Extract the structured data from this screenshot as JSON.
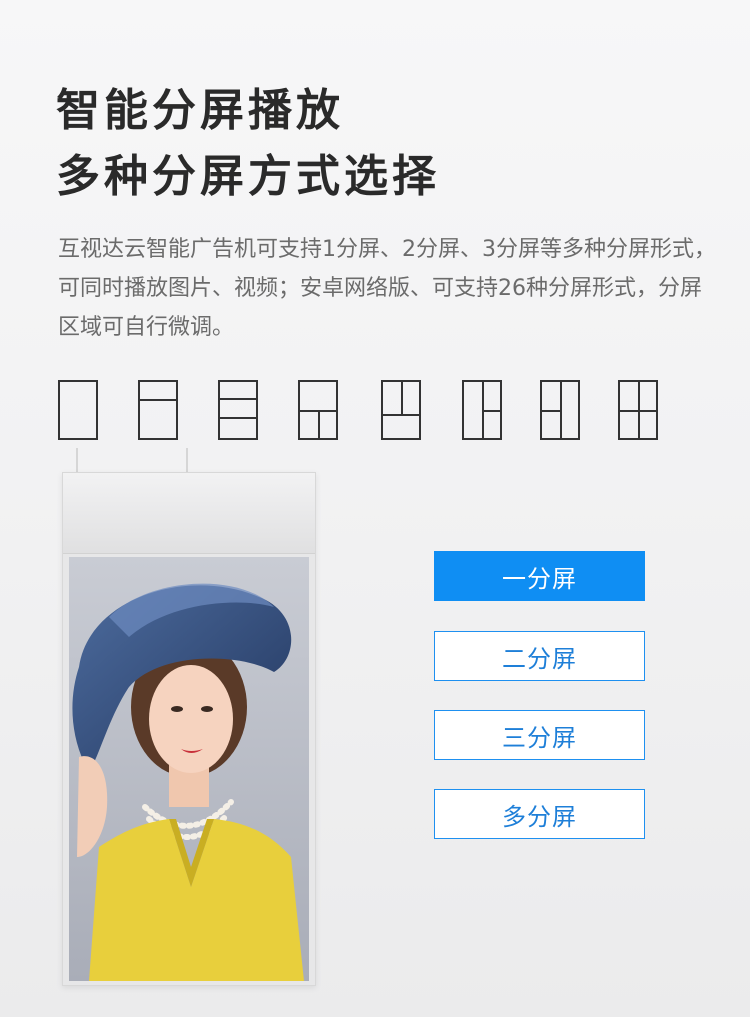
{
  "heading": {
    "line1": "智能分屏播放",
    "line2": "多种分屏方式选择"
  },
  "description": "互视达云智能广告机可支持1分屏、2分屏、3分屏等多种分屏形式，可同时播放图片、视频；安卓网络版、可支持26种分屏形式，分屏区域可自行微调。",
  "layout_icons": [
    "one-split-layout-icon",
    "two-split-layout-icon",
    "three-split-layout-icon",
    "three-split-t-layout-icon",
    "three-split-top-layout-icon",
    "three-split-side-layout-icon",
    "three-split-side-alt-layout-icon",
    "four-split-layout-icon"
  ],
  "split_options": [
    {
      "label": "一分屏",
      "selected": true
    },
    {
      "label": "二分屏",
      "selected": false
    },
    {
      "label": "三分屏",
      "selected": false
    },
    {
      "label": "多分屏",
      "selected": false
    }
  ],
  "colors": {
    "accent": "#0f8ef3",
    "accent_border": "#1e90f0",
    "title": "#2a2a2a",
    "description": "#6b6b6b",
    "icon_stroke": "#333333"
  }
}
